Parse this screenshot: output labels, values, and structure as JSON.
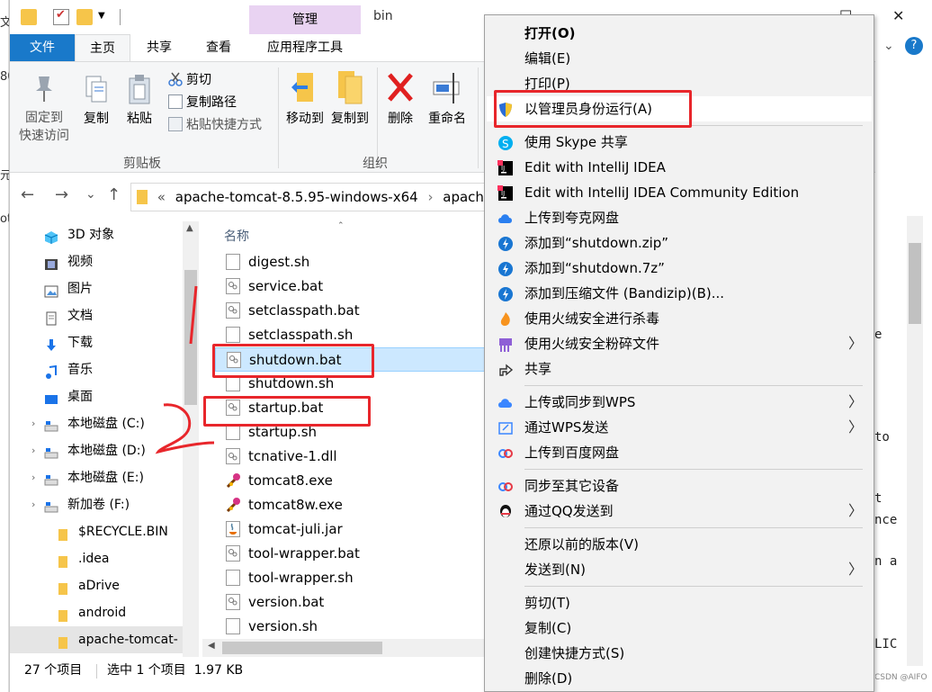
{
  "background_left": {
    "fragments": [
      "文",
      "80",
      "元",
      "ot"
    ]
  },
  "background_right": {
    "code_fragments": [
      "e",
      "to",
      "t",
      "nce",
      "n a",
      "LIC"
    ],
    "watermark": "CSDN @AIFO"
  },
  "window": {
    "title": "bin",
    "contextual_tab": "管理",
    "controls": {
      "minimize": "—",
      "maximize": "☐",
      "close": "✕"
    }
  },
  "ribbon_tabs": [
    "文件",
    "主页",
    "共享",
    "查看",
    "应用程序工具"
  ],
  "ribbon": {
    "pin_label": "固定到\n快速访问",
    "copy_label": "复制",
    "paste_label": "粘贴",
    "cut_label": "剪切",
    "copy_path_label": "复制路径",
    "paste_shortcut_label": "粘贴快捷方式",
    "clipboard_group": "剪贴板",
    "move_to_label": "移动到",
    "copy_to_label": "复制到",
    "delete_label": "删除",
    "rename_label": "重命名",
    "organize_group": "组织"
  },
  "address": {
    "nav_back": "←",
    "nav_forward": "→",
    "nav_recent": "⌄",
    "nav_up": "↑",
    "path_prefix": "«",
    "segments": [
      "apache-tomcat-8.5.95-windows-x64",
      "apache-"
    ],
    "separator": "›"
  },
  "nav_pane": [
    {
      "label": "3D 对象",
      "icon": "3d-objects-icon"
    },
    {
      "label": "视频",
      "icon": "video-icon"
    },
    {
      "label": "图片",
      "icon": "pictures-icon"
    },
    {
      "label": "文档",
      "icon": "documents-icon"
    },
    {
      "label": "下载",
      "icon": "download-icon"
    },
    {
      "label": "音乐",
      "icon": "music-icon"
    },
    {
      "label": "桌面",
      "icon": "desktop-icon"
    },
    {
      "label": "本地磁盘 (C:)",
      "icon": "drive-icon"
    },
    {
      "label": "本地磁盘 (D:)",
      "icon": "drive-icon"
    },
    {
      "label": "本地磁盘 (E:)",
      "icon": "drive-icon"
    },
    {
      "label": "新加卷 (F:)",
      "icon": "drive-icon"
    },
    {
      "label": "$RECYCLE.BIN",
      "icon": "folder-icon"
    },
    {
      "label": ".idea",
      "icon": "folder-icon"
    },
    {
      "label": "aDrive",
      "icon": "folder-icon"
    },
    {
      "label": "android",
      "icon": "folder-icon"
    },
    {
      "label": "apache-tomcat-",
      "icon": "folder-icon"
    }
  ],
  "file_list": {
    "column_name": "名称",
    "files": [
      {
        "name": "digest.sh",
        "type": "sh"
      },
      {
        "name": "service.bat",
        "type": "bat"
      },
      {
        "name": "setclasspath.bat",
        "type": "bat"
      },
      {
        "name": "setclasspath.sh",
        "type": "sh"
      },
      {
        "name": "shutdown.bat",
        "type": "bat"
      },
      {
        "name": "shutdown.sh",
        "type": "sh"
      },
      {
        "name": "startup.bat",
        "type": "bat"
      },
      {
        "name": "startup.sh",
        "type": "sh"
      },
      {
        "name": "tcnative-1.dll",
        "type": "dll"
      },
      {
        "name": "tomcat8.exe",
        "type": "exe"
      },
      {
        "name": "tomcat8w.exe",
        "type": "exe"
      },
      {
        "name": "tomcat-juli.jar",
        "type": "jar"
      },
      {
        "name": "tool-wrapper.bat",
        "type": "bat"
      },
      {
        "name": "tool-wrapper.sh",
        "type": "sh"
      },
      {
        "name": "version.bat",
        "type": "bat"
      },
      {
        "name": "version.sh",
        "type": "sh"
      }
    ]
  },
  "status_bar": {
    "item_count": "27 个项目",
    "selection": "选中 1 个项目  1.97 KB"
  },
  "context_menu": [
    {
      "label": "打开(O)",
      "bold": true,
      "icon": ""
    },
    {
      "label": "编辑(E)",
      "icon": ""
    },
    {
      "label": "打印(P)",
      "icon": ""
    },
    {
      "label": "以管理员身份运行(A)",
      "icon": "uac-shield-icon"
    },
    {
      "label": "使用 Skype 共享",
      "icon": "skype-icon"
    },
    {
      "label": "Edit with IntelliJ IDEA",
      "icon": "intellij-icon"
    },
    {
      "label": "Edit with IntelliJ IDEA Community Edition",
      "icon": "intellij-icon"
    },
    {
      "label": "上传到夸克网盘",
      "icon": "quark-cloud-icon"
    },
    {
      "label": "添加到“shutdown.zip”",
      "icon": "bandizip-icon"
    },
    {
      "label": "添加到“shutdown.7z”",
      "icon": "bandizip-icon"
    },
    {
      "label": "添加到压缩文件 (Bandizip)(B)...",
      "icon": "bandizip-icon"
    },
    {
      "label": "使用火绒安全进行杀毒",
      "icon": "huorong-icon"
    },
    {
      "label": "使用火绒安全粉碎文件",
      "icon": "huorong-shred-icon",
      "submenu": true
    },
    {
      "label": "共享",
      "icon": "share-icon"
    },
    {
      "label": "上传或同步到WPS",
      "icon": "wps-cloud-icon",
      "submenu": true
    },
    {
      "label": "通过WPS发送",
      "icon": "wps-send-icon",
      "submenu": true
    },
    {
      "label": "上传到百度网盘",
      "icon": "baidu-cloud-icon"
    },
    {
      "label": "同步至其它设备",
      "icon": "baidu-sync-icon"
    },
    {
      "label": "通过QQ发送到",
      "icon": "qq-icon",
      "submenu": true
    },
    {
      "label": "还原以前的版本(V)",
      "icon": ""
    },
    {
      "label": "发送到(N)",
      "icon": "",
      "submenu": true
    },
    {
      "label": "剪切(T)",
      "icon": ""
    },
    {
      "label": "复制(C)",
      "icon": ""
    },
    {
      "label": "创建快捷方式(S)",
      "icon": ""
    },
    {
      "label": "删除(D)",
      "icon": ""
    }
  ],
  "colors": {
    "accent": "#1979ca",
    "annotation_red": "#e8262b",
    "selection": "#cce8ff",
    "contextual_tab": "#e9d3f2"
  }
}
